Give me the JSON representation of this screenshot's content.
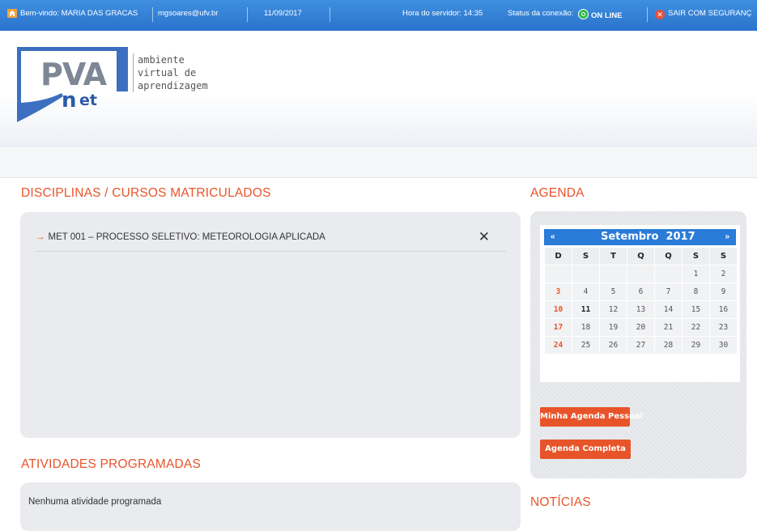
{
  "topbar": {
    "welcome": "Bem-vindo: MARIA DAS GRACAS",
    "email": "mgsoares@ufv.br",
    "date": "11/09/2017",
    "server_time": "Hora do servidor: 14:35",
    "status_label": "Status da conexão:",
    "status_value": "ON LINE",
    "logout": "SAIR COM SEGURANÇ"
  },
  "logo": {
    "mark": "PVANet",
    "line1": "ambiente",
    "line2": "virtual de",
    "line3": "aprendizagem"
  },
  "courses": {
    "title": "DISCIPLINAS / CURSOS MATRICULADOS",
    "items": [
      {
        "label": "MET 001 – PROCESSO SELETIVO: METEOROLOGIA APLICADA"
      }
    ]
  },
  "activities": {
    "title": "ATIVIDADES PROGRAMADAS",
    "empty": "Nenhuma atividade programada"
  },
  "agenda": {
    "title": "AGENDA",
    "calendar": {
      "prev": "«",
      "next": "»",
      "month": "Setembro",
      "year": "2017",
      "weekdays": [
        "D",
        "S",
        "T",
        "Q",
        "Q",
        "S",
        "S"
      ],
      "weeks": [
        [
          "",
          "",
          "",
          "",
          "",
          "1",
          "2"
        ],
        [
          "3",
          "4",
          "5",
          "6",
          "7",
          "8",
          "9"
        ],
        [
          "10",
          "11",
          "12",
          "13",
          "14",
          "15",
          "16"
        ],
        [
          "17",
          "18",
          "19",
          "20",
          "21",
          "22",
          "23"
        ],
        [
          "24",
          "25",
          "26",
          "27",
          "28",
          "29",
          "30"
        ]
      ],
      "today": "11"
    },
    "buttons": {
      "personal": "Minha Agenda Pessoal",
      "complete": "Agenda Completa"
    }
  },
  "news": {
    "title": "NOTÍCIAS"
  },
  "colors": {
    "accent": "#e8542a",
    "topbar": "#2a74cd",
    "online": "#2ebd47"
  }
}
